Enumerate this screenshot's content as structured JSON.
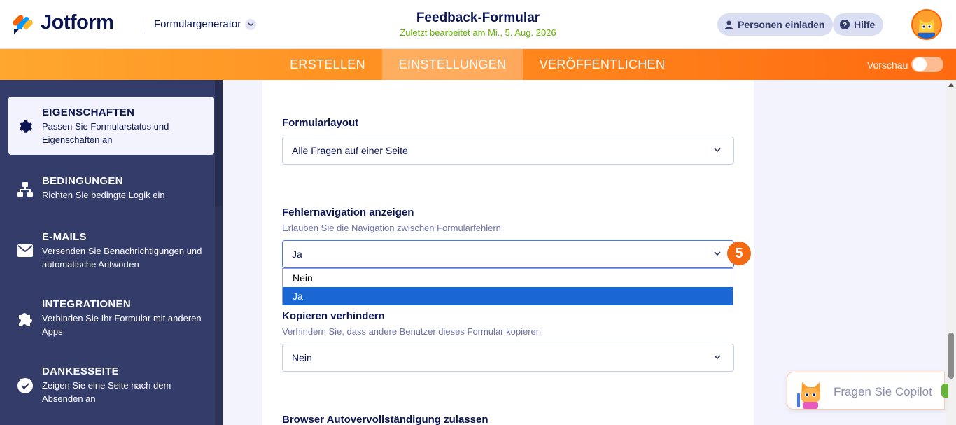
{
  "header": {
    "brand": "Jotform",
    "form_generator": "Formulargenerator",
    "form_title": "Feedback-Formular",
    "last_edited": "Zuletzt bearbeitet am Mi., 5. Aug. 2026",
    "invite_label": "Personen einladen",
    "help_label": "Hilfe"
  },
  "tabs": [
    {
      "label": "ERSTELLEN",
      "active": false
    },
    {
      "label": "EINSTELLUNGEN",
      "active": true
    },
    {
      "label": "VERÖFFENTLICHEN",
      "active": false
    }
  ],
  "preview": {
    "label": "Vorschau",
    "on": false
  },
  "sidebar": {
    "items": [
      {
        "title": "EIGENSCHAFTEN",
        "desc": "Passen Sie Formularstatus und Eigenschaften an",
        "icon": "gear-icon",
        "active": true
      },
      {
        "title": "BEDINGUNGEN",
        "desc": "Richten Sie bedingte Logik ein",
        "icon": "flow-icon",
        "active": false
      },
      {
        "title": "E-MAILS",
        "desc": "Versenden Sie Benachrichtigungen und automatische Antworten",
        "icon": "envelope-icon",
        "active": false
      },
      {
        "title": "INTEGRATIONEN",
        "desc": "Verbinden Sie Ihr Formular mit anderen Apps",
        "icon": "puzzle-icon",
        "active": false
      },
      {
        "title": "DANKESSEITE",
        "desc": "Zeigen Sie eine Seite nach dem Absenden an",
        "icon": "check-circle-icon",
        "active": false
      }
    ]
  },
  "main": {
    "layout": {
      "label": "Formularlayout",
      "value": "Alle Fragen auf einer Seite"
    },
    "error_nav": {
      "label": "Fehlernavigation anzeigen",
      "hint": "Erlauben Sie die Navigation zwischen Formularfehlern",
      "value": "Ja",
      "options": [
        "Nein",
        "Ja"
      ]
    },
    "step_badge": "5",
    "copy_protect": {
      "label": "Kopieren verhindern",
      "hint": "Verhindern Sie, dass andere Benutzer dieses Formular kopieren",
      "value": "Nein"
    },
    "autocomplete": {
      "label": "Browser Autovervollständigung zulassen"
    }
  },
  "copilot": {
    "label": "Fragen Sie Copilot"
  },
  "colors": {
    "brand_orange": "#ff6100",
    "navy": "#0a1551",
    "sidebar": "#343c6a",
    "selected_option": "#1a67d4"
  }
}
